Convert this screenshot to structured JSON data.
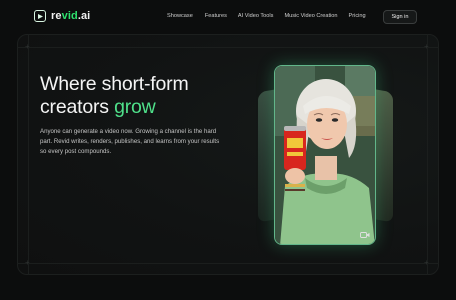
{
  "brand": {
    "name_prefix": "re",
    "name_accent": "vid",
    "name_suffix": ".ai",
    "accent_color": "#2ee06e"
  },
  "nav": {
    "links": [
      "Showcase",
      "Features",
      "AI Video Tools",
      "Music Video Creation",
      "Pricing"
    ],
    "signin_label": "Sign in"
  },
  "hero": {
    "title_line1": "Where short-form",
    "title_line2_prefix": "creators ",
    "title_line2_accent": "grow",
    "description": "Anyone can generate a video now. Growing a channel is the hard part. Revid writes, renders, publishes, and learns from your results so every post compounds.",
    "accent_color": "#4fe08a"
  },
  "video_card": {
    "icon": "video-camera-icon"
  }
}
